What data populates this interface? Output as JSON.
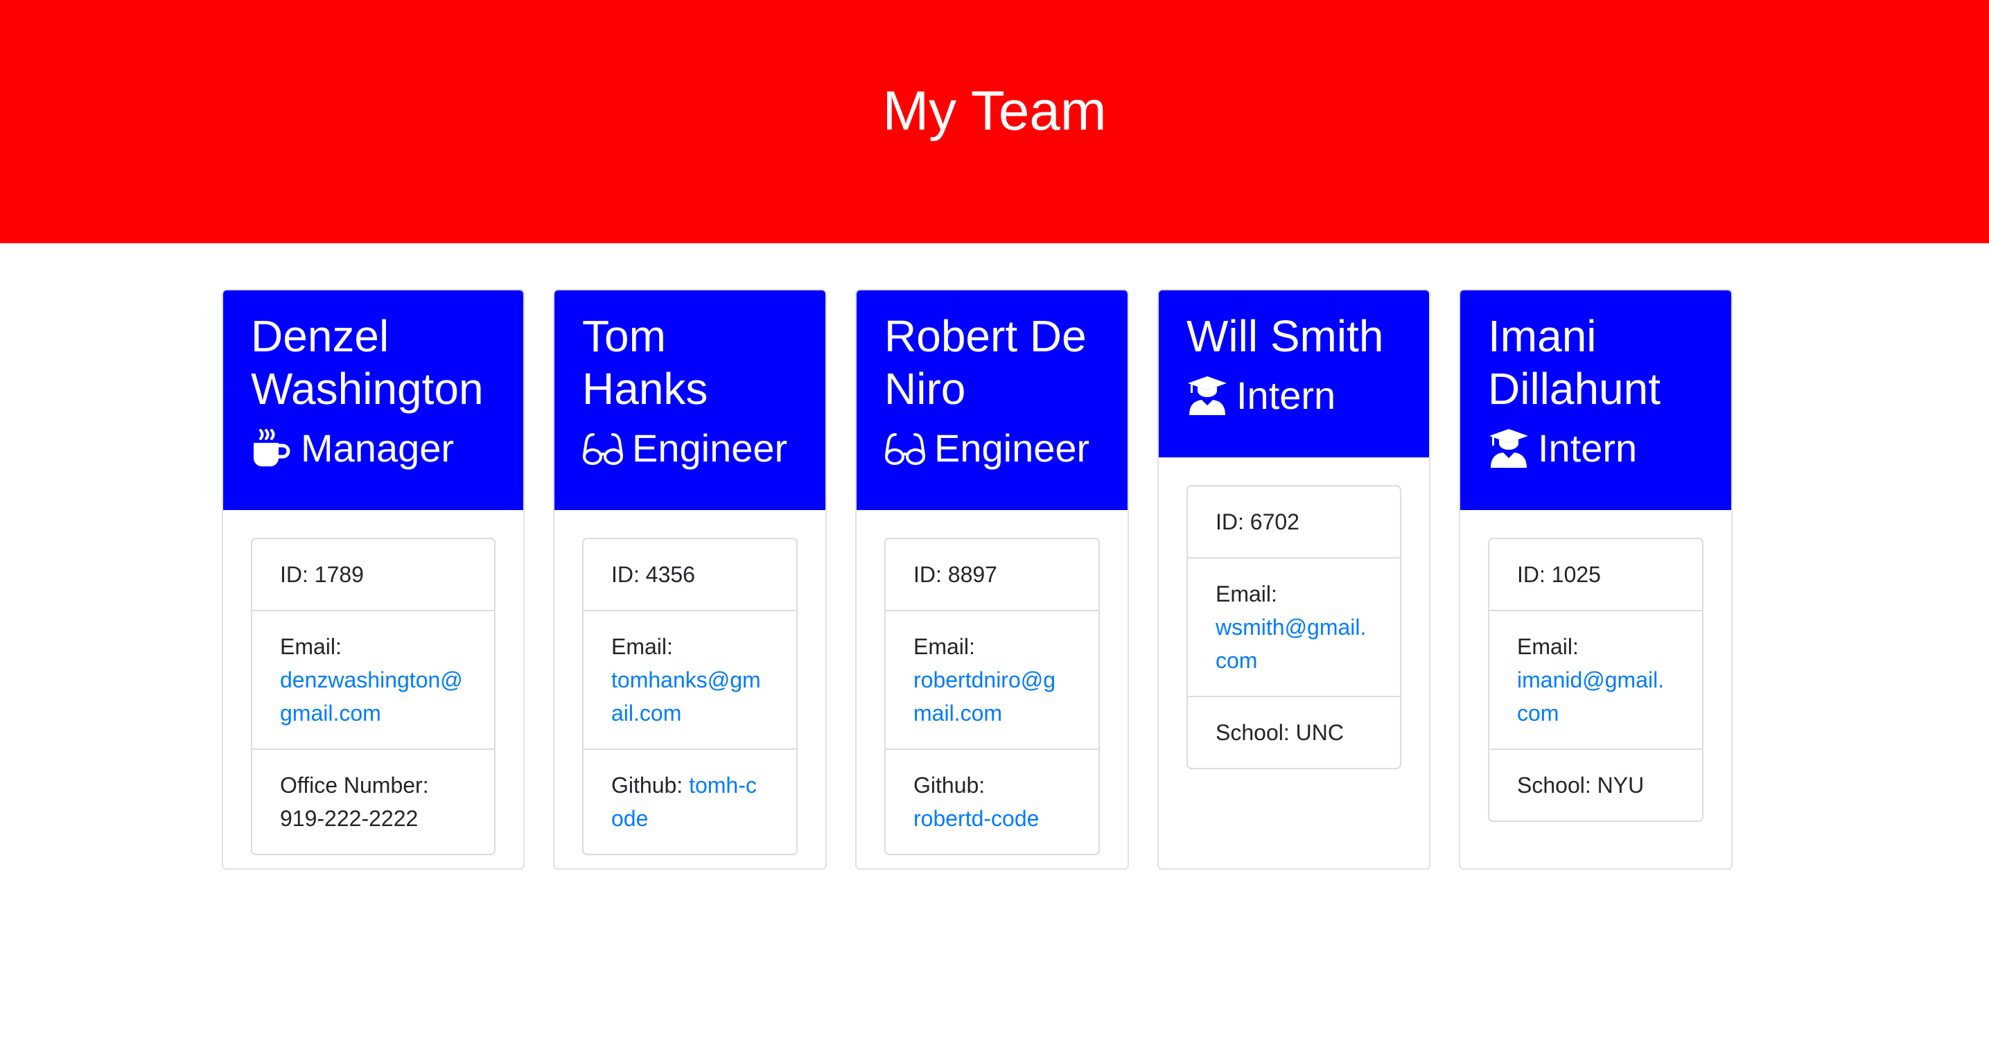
{
  "header": {
    "title": "My Team"
  },
  "colors": {
    "banner": "#ff0000",
    "card_header": "#0000ff",
    "link": "#007bff"
  },
  "employees": [
    {
      "name": "Denzel Washington",
      "role": "Manager",
      "icon": "mug-hot-icon",
      "id_text": "ID: 1789",
      "email_label": "Email:",
      "email": "denzwashington@gmail.com",
      "extra_label": "Office Number:",
      "extra_value": "919-222-2222"
    },
    {
      "name": "Tom Hanks",
      "role": "Engineer",
      "icon": "glasses-icon",
      "id_text": "ID: 4356",
      "email_label": "Email:",
      "email": "tomhanks@gmail.com",
      "extra_label": "Github:",
      "extra_value": "tomh-code"
    },
    {
      "name": "Robert De Niro",
      "role": "Engineer",
      "icon": "glasses-icon",
      "id_text": "ID: 8897",
      "email_label": "Email:",
      "email": "robertdniro@gmail.com",
      "extra_label": "Github:",
      "extra_value": "robertd-code"
    },
    {
      "name": "Will Smith",
      "role": "Intern",
      "icon": "graduate-icon",
      "id_text": "ID: 6702",
      "email_label": "Email:",
      "email": "wsmith@gmail.com",
      "extra_label": "School: UNC",
      "extra_value": ""
    },
    {
      "name": "Imani Dillahunt",
      "role": "Intern",
      "icon": "graduate-icon",
      "id_text": "ID: 1025",
      "email_label": "Email:",
      "email": "imanid@gmail.com",
      "extra_label": "School: NYU",
      "extra_value": ""
    }
  ]
}
